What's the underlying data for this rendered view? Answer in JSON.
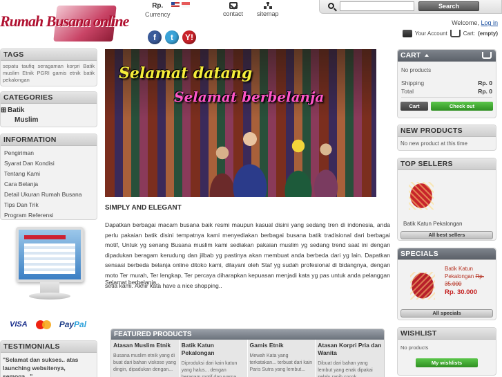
{
  "header": {
    "logo_text": "Rumah Busana online",
    "currency_symbol": "Rp.",
    "currency_label": "Currency",
    "contact_label": "contact",
    "sitemap_label": "sitemap",
    "social": {
      "facebook": "f",
      "twitter": "t",
      "yahoo": "Y!"
    },
    "search": {
      "placeholder": "",
      "button_label": "Search"
    },
    "welcome_text": "Welcome,",
    "login_label": "Log in",
    "account_label": "Your Account",
    "cart_label": "Cart:",
    "cart_status": "(empty)"
  },
  "left": {
    "tags": {
      "title": "TAGS",
      "text": "sepatu taufiq seragaman korpri Batik muslim Etnik PGRI gamis etnik batik pekalongan"
    },
    "categories": {
      "title": "CATEGORIES",
      "items": [
        {
          "label": "Batik",
          "expand": "⊞"
        },
        {
          "label": "Muslim"
        }
      ]
    },
    "information": {
      "title": "INFORMATION",
      "links": [
        "Pengiriman",
        "Syarat Dan Kondisi",
        "Tentang Kami",
        "Cara Belanja",
        "Detail Ukuran Rumah Busana",
        "Tips Dan Trik",
        "Program Referensi"
      ]
    },
    "payments": {
      "visa": "VISA",
      "paypal_a": "Pay",
      "paypal_b": "Pal"
    },
    "testimonials": {
      "title": "TESTIMONIALS",
      "text": "\"Selamat dan sukses.. atas launching websitenya, semoga...\""
    }
  },
  "main": {
    "banner": {
      "line1": "Selamat datang",
      "line2": "Selamat berbelanja"
    },
    "content_title": "SIMPLY AND ELEGANT",
    "paragraph": "Dapatkan berbagai macam busana baik resmi maupun kasual disini yang sedang tren di indonesia, anda perlu pakaian batik disini tempatnya kami menyediakan berbagai busana batik tradisional dari berbagai motif, Untuk yg senang Busana muslim kami sediakan pakaian muslim yg sedang trend saat ini dengan dipadukan beragam kerudung dan jilbab yg pastinya akan membuat anda berbeda dari yg lain. Dapatkan sensasi berbeda belanja online ditoko kami, dilayani oleh Staf yg sudah profesional di bidangnya, dengan moto Ter murah, Ter lengkap, Ter percaya diharapkan kepuasan menjadi kata yg pas untuk anda pelanggan setia kami. Akhir kata have a nice shopping..",
    "closing": "Selamat berbelanja..",
    "featured": {
      "title": "FEATURED PRODUCTS",
      "items": [
        {
          "name": "Atasan Muslim Etnik",
          "desc": "Busana muslim etnik yang di buat dari bahan viskose yang dingin, dipadukan dengan..."
        },
        {
          "name": "Batik Katun Pekalongan",
          "desc": "Diproduksi dari kain katun yang halus... dengan beragam motif dan warna..."
        },
        {
          "name": "Gamis Etnik",
          "desc": "Mewah Kata yang terkatakan... terbuat dari kain Paris Sutra yang lembut..."
        },
        {
          "name": "Atasan Korpri Pria dan Wanita",
          "desc": "Dibuat dari bahan yang lembut yang enak dipakai selalu rapih cocok sekaligus..."
        }
      ]
    }
  },
  "right": {
    "cart": {
      "title": "CART",
      "no_products": "No products",
      "shipping_label": "Shipping",
      "shipping_value": "Rp. 0",
      "total_label": "Total",
      "total_value": "Rp. 0",
      "cart_button": "Cart",
      "checkout_button": "Check out"
    },
    "new_products": {
      "title": "NEW PRODUCTS",
      "text": "No new product at this time"
    },
    "top_sellers": {
      "title": "TOP SELLERS",
      "product": "Batik Katun Pekalongan",
      "button": "All best sellers"
    },
    "specials": {
      "title": "SPECIALS",
      "product": "Batik Katun Pekalongan",
      "old_price": "Rp. 35.000",
      "price": "Rp. 30.000",
      "button": "All specials"
    },
    "wishlist": {
      "title": "WISHLIST",
      "text": "No products",
      "button": "My wishlists"
    }
  },
  "colors": {
    "accent_green": "#2f8f22",
    "title_gray": "#5b6068",
    "logo_red": "#b01030",
    "price_red": "#c42020"
  }
}
